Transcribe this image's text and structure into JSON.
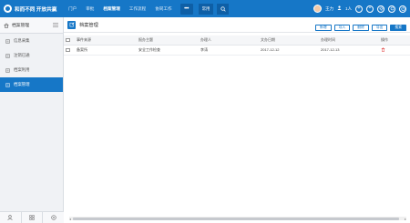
{
  "brand": {
    "name": "和而不同 开放共赢"
  },
  "nav": [
    {
      "label": "门户",
      "active": false
    },
    {
      "label": "审批",
      "active": false
    },
    {
      "label": "档案管理",
      "active": true
    },
    {
      "label": "工作流程",
      "active": false
    },
    {
      "label": "协同工作",
      "active": false
    }
  ],
  "nav_more": "•••",
  "nav_common": "常用",
  "user": {
    "name": "王力",
    "count": "1人"
  },
  "sidebar": {
    "title": "档案管理",
    "items": [
      {
        "label": "信息采集",
        "active": false
      },
      {
        "label": "注销已通",
        "active": false
      },
      {
        "label": "档案利用",
        "active": false
      },
      {
        "label": "档案管理",
        "active": true
      }
    ]
  },
  "main": {
    "title": "档案管理",
    "actions": [
      "新增",
      "导入",
      "删除",
      "导出",
      "搜索"
    ]
  },
  "table": {
    "headers": [
      "事件来源",
      "报办主题",
      "办理人",
      "文办日期",
      "办理时间",
      "操作"
    ],
    "rows": [
      {
        "source": "备案所",
        "subject": "安全工作检查",
        "person": "李涛",
        "date": "2017-12-12",
        "time": "2017-12-13"
      }
    ]
  },
  "colors": {
    "accent": "#1677c7",
    "delete": "#e04646"
  }
}
